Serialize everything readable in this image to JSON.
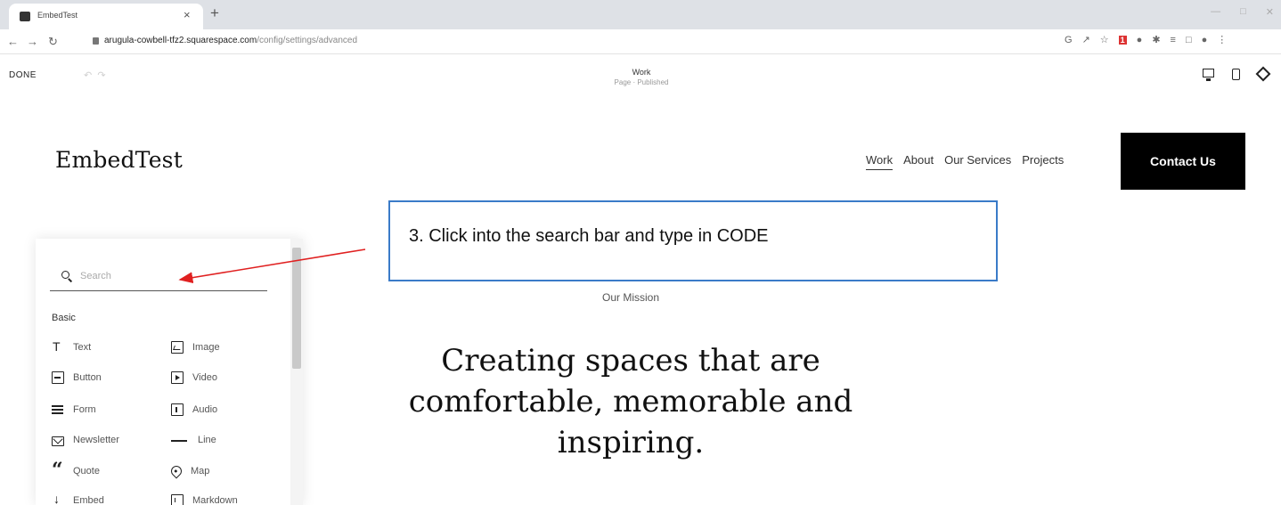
{
  "browser": {
    "tab_title": "EmbedTest",
    "tab_close": "×",
    "new_tab": "+",
    "url_host": "arugula-cowbell-tfz2.squarespace.com",
    "url_path": "/config/settings/advanced"
  },
  "editor": {
    "done_label": "DONE",
    "page_title": "Work",
    "page_status": "Page · Published"
  },
  "site": {
    "logo": "EmbedTest",
    "nav": {
      "work": "Work",
      "about": "About",
      "services": "Our Services",
      "projects": "Projects"
    },
    "contact_label": "Contact Us",
    "mission": "Our Mission",
    "headline": "Creating spaces that are comfortable, memorable and inspiring."
  },
  "panel": {
    "search_placeholder": "Search",
    "section_basic": "Basic",
    "blocks": {
      "text": "Text",
      "image": "Image",
      "button": "Button",
      "video": "Video",
      "form": "Form",
      "audio": "Audio",
      "newsletter": "Newsletter",
      "line": "Line",
      "quote": "Quote",
      "map": "Map",
      "embed": "Embed",
      "markdown": "Markdown"
    }
  },
  "overlay": {
    "instruction": "3. Click into the search bar and type in CODE",
    "border_color": "#3a7bc8",
    "arrow_color": "#e02020"
  }
}
